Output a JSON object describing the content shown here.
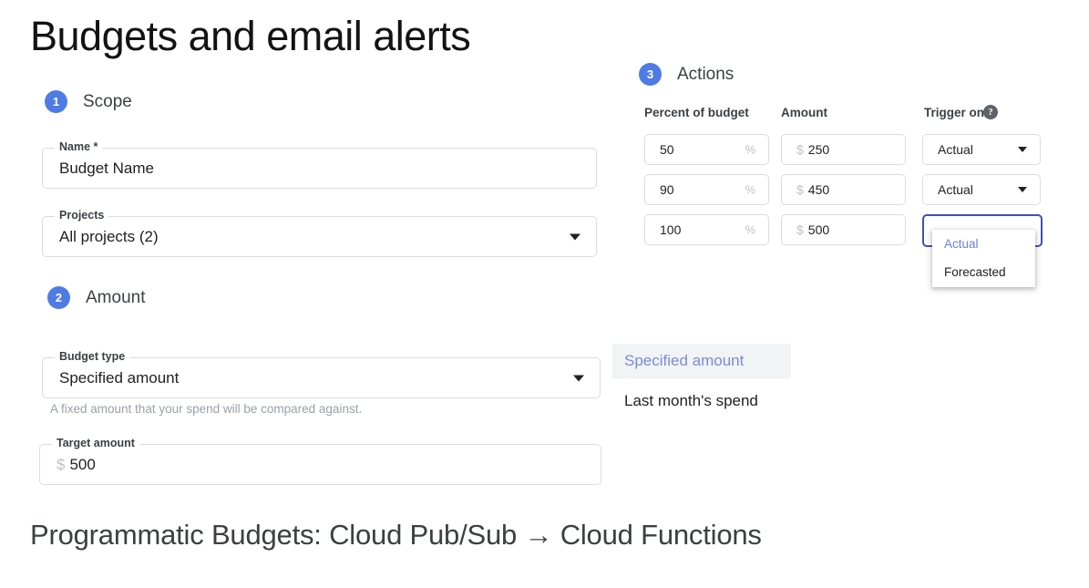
{
  "slide": {
    "title": "Budgets and email alerts",
    "caption": "Programmatic Budgets: Cloud Pub/Sub → Cloud Functions"
  },
  "colors": {
    "badge_blue": "#4f7be4",
    "focus_blue": "#3f51b5",
    "selected_text_blue": "#6b7fd7",
    "border_grey": "#dadce0",
    "helper_grey": "#9aa0a6"
  },
  "scope": {
    "step_number": "1",
    "step_label": "Scope",
    "name_field": {
      "label": "Name *",
      "value": "Budget Name"
    },
    "projects_field": {
      "label": "Projects",
      "value": "All projects (2)",
      "caret_icon": "chevron-down-icon"
    }
  },
  "amount": {
    "step_number": "2",
    "step_label": "Amount",
    "budget_type_field": {
      "label": "Budget type",
      "value": "Specified amount",
      "caret_icon": "chevron-down-icon"
    },
    "budget_type_helper": "A fixed amount that your spend will be compared against.",
    "budget_type_options": [
      {
        "label": "Specified amount",
        "selected": true
      },
      {
        "label": "Last month's spend",
        "selected": false
      }
    ],
    "target_amount_field": {
      "label": "Target amount",
      "prefix": "$",
      "value": "500"
    }
  },
  "actions": {
    "step_number": "3",
    "step_label": "Actions",
    "columns": {
      "percent": "Percent of budget",
      "amount": "Amount",
      "trigger": "Trigger on",
      "help_icon": "help-icon",
      "help_glyph": "?"
    },
    "percent_suffix": "%",
    "amount_prefix": "$",
    "rows": [
      {
        "percent": "50",
        "amount": "250",
        "trigger": "Actual",
        "focused": false
      },
      {
        "percent": "90",
        "amount": "450",
        "trigger": "Actual",
        "focused": false
      },
      {
        "percent": "100",
        "amount": "500",
        "trigger": "",
        "focused": true
      }
    ],
    "trigger_menu": {
      "open": true,
      "items": [
        {
          "label": "Actual",
          "selected": true
        },
        {
          "label": "Forecasted",
          "selected": false
        }
      ]
    }
  }
}
